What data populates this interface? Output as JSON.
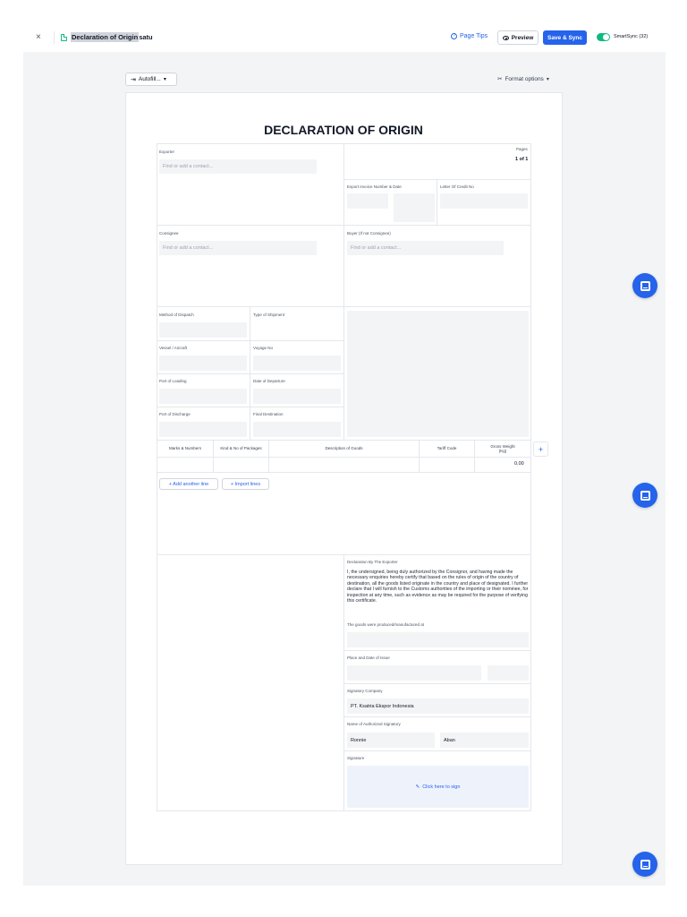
{
  "topbar": {
    "close": "×",
    "title_highlight": "Declaration of Origin",
    "title_rest": " satu",
    "page_tips": "Page Tips",
    "preview": "Preview",
    "save_sync": "Save & Sync",
    "smartsync": "SmartSync (32)"
  },
  "toolbar": {
    "autofill": "Autofill...",
    "format_options": "Format options"
  },
  "form": {
    "title": "DECLARATION OF ORIGIN",
    "exporter_label": "Exporter",
    "exporter_placeholder": "Find or add a contact...",
    "pages_label": "Pages",
    "pages_value": "1 of 1",
    "invoice_label": "Export Invoice Number & Date",
    "letter_credit_label": "Letter Of Credit No",
    "consignee_label": "Consignee",
    "consignee_placeholder": "Find or add a contact...",
    "buyer_label": "Buyer (If not Consignee)",
    "buyer_placeholder": "Find or add a contact...",
    "method_dispatch": "Method of Dispatch",
    "type_shipment": "Type of Shipment",
    "vessel": "Vessel / Aircraft",
    "voyage": "Voyage No",
    "port_loading": "Port of Loading",
    "date_departure": "Date of Departure",
    "port_discharge": "Port of Discharge",
    "final_destination": "Final Destination",
    "table": {
      "headers": [
        "Marks & Numbers",
        "Kind & No of Packages",
        "Description of Goods",
        "Tariff Code",
        "Gross Weight (Kg)"
      ],
      "gross_total": "0.00"
    },
    "add_line": "+ Add another line",
    "import_lines": "+ Import lines",
    "declaration_label": "Declaration By The Exporter",
    "declaration_text": "I, the undersigned, being duly authorized by the Consignor, and having made the necessary enquiries hereby certify that based on the rules of origin of the country of destination, all the goods listed originate in the country and place of designated. I further declare that I will furnish to the Customs authorities of the importing or their nominee, for inspection at any time, such as evidence as may be required for the purpose of verifying this certificate.",
    "produced_label": "The goods were produced/manufactured at",
    "place_date_label": "Place and Date of Issue",
    "signatory_company_label": "Signatory Company",
    "signatory_company_value": "PT. Ksatria Ekspor Indonesia",
    "authorized_label": "Name of Authorized Signatory",
    "first_name": "Ronnie",
    "last_name": "Aban",
    "signature_label": "Signature",
    "click_sign": "Click here to sign"
  }
}
